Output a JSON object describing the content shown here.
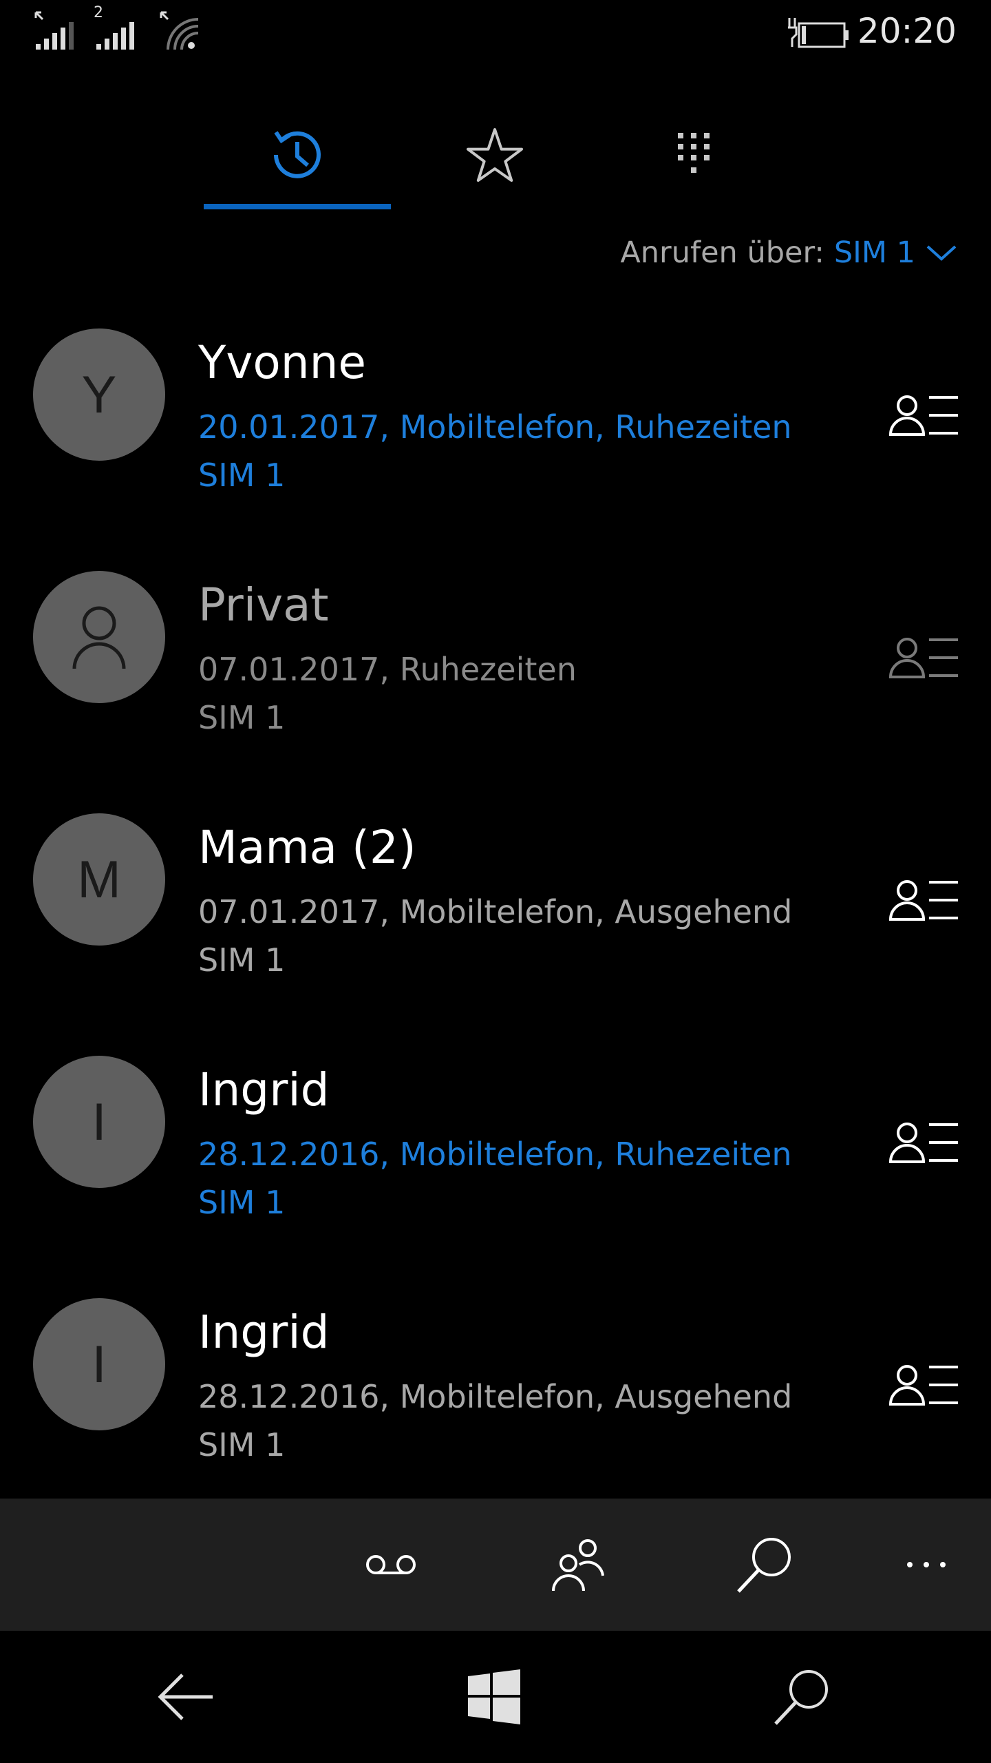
{
  "status_bar": {
    "sim1_label": "",
    "sim2_label": "2",
    "time": "20:20"
  },
  "tabs": [
    {
      "name": "history",
      "icon": "history-icon",
      "active": true
    },
    {
      "name": "favorites",
      "icon": "star-icon",
      "active": false
    },
    {
      "name": "keypad",
      "icon": "dialpad-icon",
      "active": false
    }
  ],
  "call_via": {
    "label": "Anrufen über:",
    "value": "SIM 1"
  },
  "calls": [
    {
      "avatar": "Y",
      "name": "Yvonne",
      "detail": "20.01.2017, Mobiltelefon, Ruhezeiten",
      "sim": "SIM 1",
      "style": "missed"
    },
    {
      "avatar": "",
      "name": "Privat",
      "detail": "07.01.2017, Ruhezeiten",
      "sim": "SIM 1",
      "style": "private"
    },
    {
      "avatar": "M",
      "name": "Mama (2)",
      "detail": "07.01.2017, Mobiltelefon, Ausgehend",
      "sim": "SIM 1",
      "style": "normal"
    },
    {
      "avatar": "I",
      "name": "Ingrid",
      "detail": "28.12.2016, Mobiltelefon, Ruhezeiten",
      "sim": "SIM 1",
      "style": "missed"
    },
    {
      "avatar": "I",
      "name": "Ingrid",
      "detail": "28.12.2016, Mobiltelefon, Ausgehend",
      "sim": "SIM 1",
      "style": "normal"
    }
  ],
  "app_bar": {
    "buttons": [
      "voicemail-icon",
      "contacts-icon",
      "search-icon",
      "more-icon"
    ]
  },
  "nav_bar": {
    "buttons": [
      "back-icon",
      "windows-icon",
      "search-icon"
    ]
  },
  "colors": {
    "accent": "#1e7fdc",
    "background": "#000000",
    "app_bar": "#1f1f1f",
    "avatar": "#5f5f5f"
  }
}
